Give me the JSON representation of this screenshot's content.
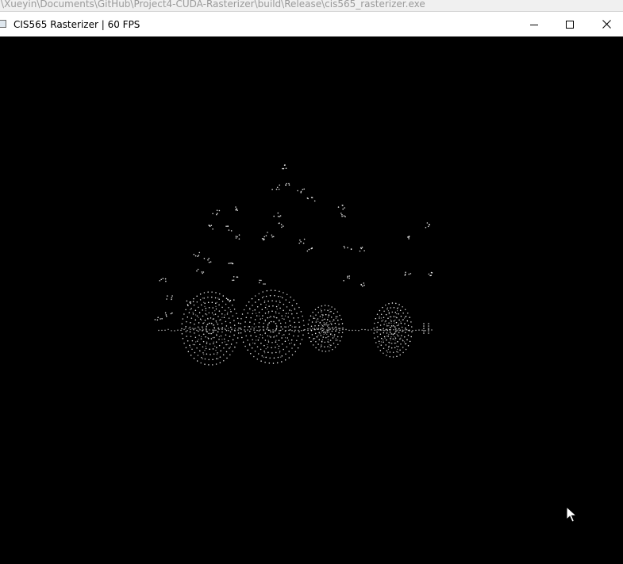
{
  "background_window": {
    "path": ":\\Xueyin\\Documents\\GitHub\\Project4-CUDA-Rasterizer\\build\\Release\\cis565_rasterizer.exe"
  },
  "window": {
    "title": "CIS565 Rasterizer | 60 FPS",
    "controls": {
      "minimize_icon": "minimize-icon",
      "maximize_icon": "maximize-icon",
      "close_icon": "close-icon"
    }
  },
  "viewport": {
    "background_color": "#000000",
    "point_color": "#ffffff",
    "content": "point-cloud-truck-render"
  },
  "cursor": {
    "icon": "arrow-cursor-icon"
  }
}
